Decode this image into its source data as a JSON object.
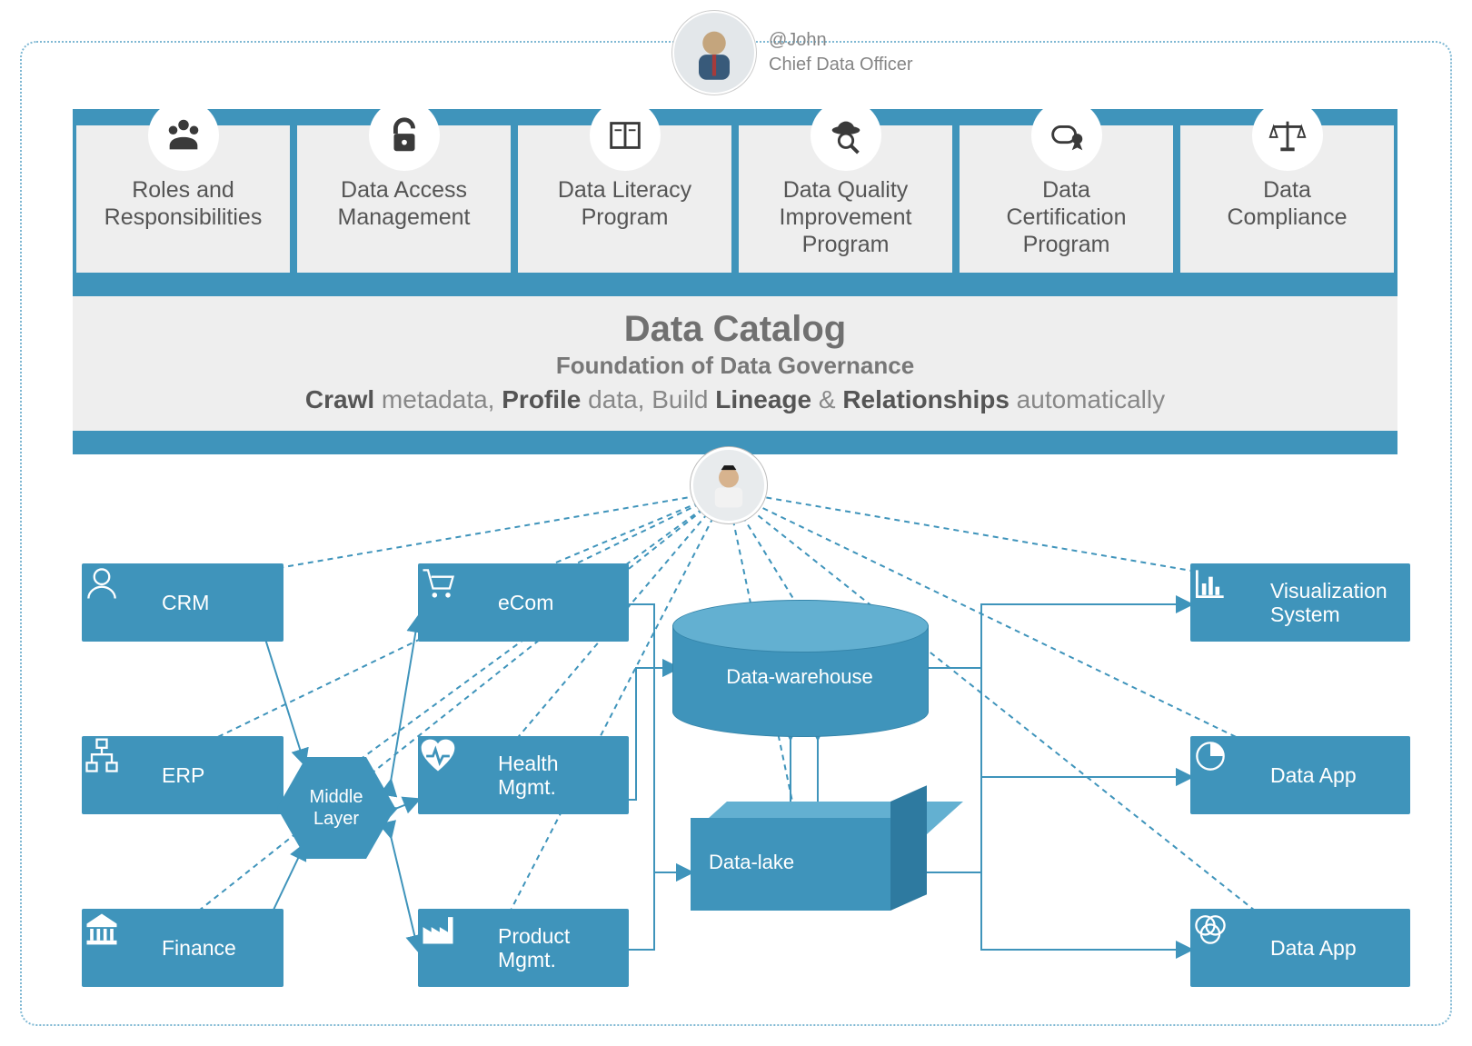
{
  "persona": {
    "handle": "@John",
    "title": "Chief Data Officer"
  },
  "tabs": [
    {
      "label": "Roles and\nResponsibilities",
      "icon": "people"
    },
    {
      "label": "Data Access\nManagement",
      "icon": "lock"
    },
    {
      "label": "Data Literacy\nProgram",
      "icon": "book"
    },
    {
      "label": "Data Quality\nImprovement\nProgram",
      "icon": "detective"
    },
    {
      "label": "Data\nCertification\nProgram",
      "icon": "certificate"
    },
    {
      "label": "Data\nCompliance",
      "icon": "scale"
    }
  ],
  "catalog": {
    "title": "Data Catalog",
    "subtitle": "Foundation of Data Governance",
    "line": {
      "p1": "Crawl",
      "t1": " metadata, ",
      "p2": "Profile",
      "t2": " data, Build ",
      "p3": "Lineage",
      "t3": " & ",
      "p4": "Relationships",
      "t4": " automatically"
    }
  },
  "sources_left": [
    {
      "label": "CRM",
      "icon": "user"
    },
    {
      "label": "ERP",
      "icon": "flow"
    },
    {
      "label": "Finance",
      "icon": "bank"
    }
  ],
  "middle": {
    "label": "Middle\nLayer"
  },
  "sources_mid": [
    {
      "label": "eCom",
      "icon": "cart"
    },
    {
      "label": "Health\nMgmt.",
      "icon": "heart"
    },
    {
      "label": "Product\nMgmt.",
      "icon": "factory"
    }
  ],
  "stores": {
    "dw": "Data-warehouse",
    "dl": "Data-lake"
  },
  "outputs": [
    {
      "label": "Visualization\nSystem",
      "icon": "chart"
    },
    {
      "label": "Data App",
      "icon": "pie"
    },
    {
      "label": "Data App",
      "icon": "venn"
    }
  ],
  "colors": {
    "blue": "#3f94bb",
    "light": "#eeeeee"
  }
}
